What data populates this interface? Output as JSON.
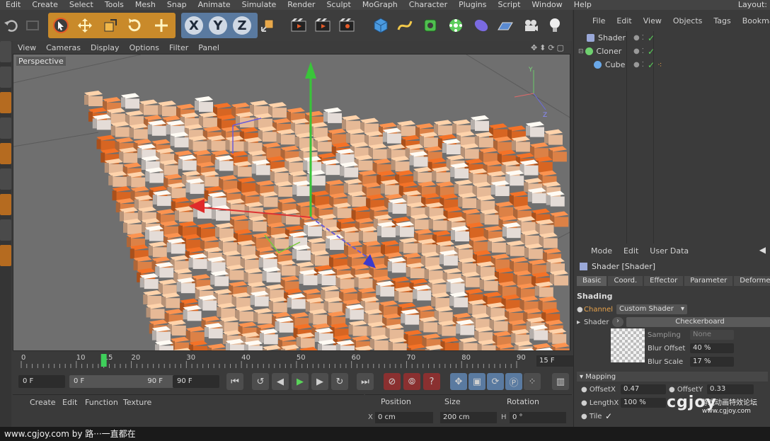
{
  "menu": [
    "Edit",
    "Create",
    "Select",
    "Tools",
    "Mesh",
    "Snap",
    "Animate",
    "Simulate",
    "Render",
    "Sculpt",
    "MoGraph",
    "Character",
    "Plugins",
    "Script",
    "Window",
    "Help"
  ],
  "layout_label": "Layout:",
  "toolbar": {
    "axis_x": "X",
    "axis_y": "Y",
    "axis_z": "Z"
  },
  "viewport": {
    "menu": [
      "View",
      "Cameras",
      "Display",
      "Options",
      "Filter",
      "Panel"
    ],
    "label": "Perspective",
    "nav_icons": "✥⬍⟳▢",
    "axis_y": "Y",
    "axis_z": "Z",
    "checkerboard": {
      "mark_palette": [
        "#f0e8e2",
        "#f2c39e",
        "#e8884a",
        "#e26a24",
        "#d85a18"
      ],
      "background": "#6f6f6f"
    }
  },
  "timeline": {
    "ticks": [
      0,
      10,
      15,
      20,
      30,
      40,
      50,
      60,
      70,
      80,
      90
    ],
    "current_frame": 15,
    "frame_field": "15 F",
    "start_field": "0 F",
    "min_field": "0 F",
    "max_field": "90 F",
    "end_field": "90 F"
  },
  "material_panel": {
    "menu": [
      "Create",
      "Edit",
      "Function",
      "Texture"
    ]
  },
  "coord_panel": {
    "headers": [
      "Position",
      "Size",
      "Rotation"
    ],
    "x_label": "X",
    "x_value": "0 cm",
    "size_value": "200 cm",
    "h_label": "H",
    "rot_value": "0 °"
  },
  "object_manager": {
    "menu": [
      "File",
      "Edit",
      "View",
      "Objects",
      "Tags",
      "Bookmarks"
    ],
    "items": [
      {
        "name": "Shader",
        "color": "#9aa8d8"
      },
      {
        "name": "Cloner",
        "color": "#6fd06f"
      },
      {
        "name": "Cube",
        "color": "#6aa8e8"
      }
    ]
  },
  "attributes": {
    "menu": [
      "Mode",
      "Edit",
      "User Data"
    ],
    "title": "Shader [Shader]",
    "tabs": [
      "Basic",
      "Coord.",
      "Effector",
      "Parameter",
      "Deformer"
    ],
    "section_shading": "Shading",
    "channel_label": "Channel",
    "channel_value": "Custom Shader",
    "shader_label": "Shader",
    "shader_value": "Checkerboard",
    "sampling_label": "Sampling",
    "sampling_value": "None",
    "blur_offset_label": "Blur Offset",
    "blur_offset_value": "40 %",
    "blur_scale_label": "Blur Scale",
    "blur_scale_value": "17 %",
    "section_mapping": "Mapping",
    "offsetx_label": "OffsetX",
    "offsetx_value": "0.47",
    "offsety_label": "OffsetY",
    "offsety_value": "0.33",
    "lengthx_label": "LengthX",
    "lengthx_value": "100 %",
    "tile_label": "Tile",
    "tile_check": "✓"
  },
  "watermark": {
    "text": "www.cgjoy.com by 路···一直都在",
    "logo": "cgjoy",
    "sub": "游戏动画特效论坛",
    "url": "www.cgjoy.com"
  },
  "colors": {
    "accent_blue": "#5a7aa0",
    "orange": "#e8701e",
    "check_green": "#5ad45a"
  }
}
